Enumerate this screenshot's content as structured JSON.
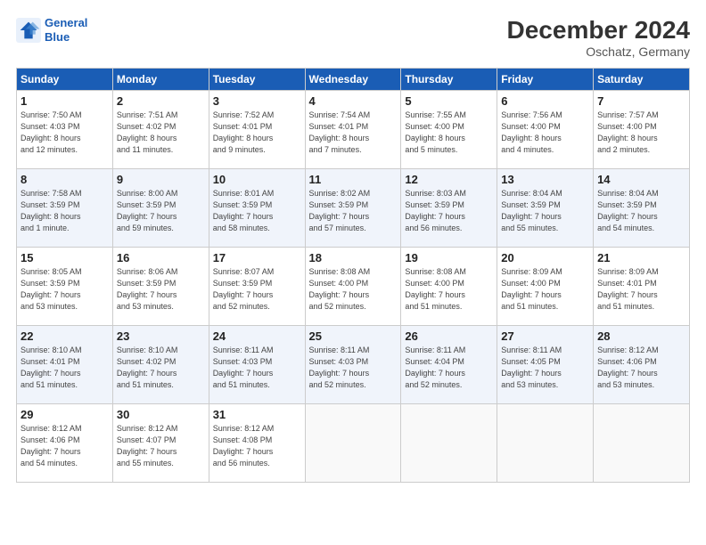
{
  "header": {
    "logo_line1": "General",
    "logo_line2": "Blue",
    "month_year": "December 2024",
    "location": "Oschatz, Germany"
  },
  "weekdays": [
    "Sunday",
    "Monday",
    "Tuesday",
    "Wednesday",
    "Thursday",
    "Friday",
    "Saturday"
  ],
  "weeks": [
    [
      {
        "day": "1",
        "info": "Sunrise: 7:50 AM\nSunset: 4:03 PM\nDaylight: 8 hours\nand 12 minutes."
      },
      {
        "day": "2",
        "info": "Sunrise: 7:51 AM\nSunset: 4:02 PM\nDaylight: 8 hours\nand 11 minutes."
      },
      {
        "day": "3",
        "info": "Sunrise: 7:52 AM\nSunset: 4:01 PM\nDaylight: 8 hours\nand 9 minutes."
      },
      {
        "day": "4",
        "info": "Sunrise: 7:54 AM\nSunset: 4:01 PM\nDaylight: 8 hours\nand 7 minutes."
      },
      {
        "day": "5",
        "info": "Sunrise: 7:55 AM\nSunset: 4:00 PM\nDaylight: 8 hours\nand 5 minutes."
      },
      {
        "day": "6",
        "info": "Sunrise: 7:56 AM\nSunset: 4:00 PM\nDaylight: 8 hours\nand 4 minutes."
      },
      {
        "day": "7",
        "info": "Sunrise: 7:57 AM\nSunset: 4:00 PM\nDaylight: 8 hours\nand 2 minutes."
      }
    ],
    [
      {
        "day": "8",
        "info": "Sunrise: 7:58 AM\nSunset: 3:59 PM\nDaylight: 8 hours\nand 1 minute."
      },
      {
        "day": "9",
        "info": "Sunrise: 8:00 AM\nSunset: 3:59 PM\nDaylight: 7 hours\nand 59 minutes."
      },
      {
        "day": "10",
        "info": "Sunrise: 8:01 AM\nSunset: 3:59 PM\nDaylight: 7 hours\nand 58 minutes."
      },
      {
        "day": "11",
        "info": "Sunrise: 8:02 AM\nSunset: 3:59 PM\nDaylight: 7 hours\nand 57 minutes."
      },
      {
        "day": "12",
        "info": "Sunrise: 8:03 AM\nSunset: 3:59 PM\nDaylight: 7 hours\nand 56 minutes."
      },
      {
        "day": "13",
        "info": "Sunrise: 8:04 AM\nSunset: 3:59 PM\nDaylight: 7 hours\nand 55 minutes."
      },
      {
        "day": "14",
        "info": "Sunrise: 8:04 AM\nSunset: 3:59 PM\nDaylight: 7 hours\nand 54 minutes."
      }
    ],
    [
      {
        "day": "15",
        "info": "Sunrise: 8:05 AM\nSunset: 3:59 PM\nDaylight: 7 hours\nand 53 minutes."
      },
      {
        "day": "16",
        "info": "Sunrise: 8:06 AM\nSunset: 3:59 PM\nDaylight: 7 hours\nand 53 minutes."
      },
      {
        "day": "17",
        "info": "Sunrise: 8:07 AM\nSunset: 3:59 PM\nDaylight: 7 hours\nand 52 minutes."
      },
      {
        "day": "18",
        "info": "Sunrise: 8:08 AM\nSunset: 4:00 PM\nDaylight: 7 hours\nand 52 minutes."
      },
      {
        "day": "19",
        "info": "Sunrise: 8:08 AM\nSunset: 4:00 PM\nDaylight: 7 hours\nand 51 minutes."
      },
      {
        "day": "20",
        "info": "Sunrise: 8:09 AM\nSunset: 4:00 PM\nDaylight: 7 hours\nand 51 minutes."
      },
      {
        "day": "21",
        "info": "Sunrise: 8:09 AM\nSunset: 4:01 PM\nDaylight: 7 hours\nand 51 minutes."
      }
    ],
    [
      {
        "day": "22",
        "info": "Sunrise: 8:10 AM\nSunset: 4:01 PM\nDaylight: 7 hours\nand 51 minutes."
      },
      {
        "day": "23",
        "info": "Sunrise: 8:10 AM\nSunset: 4:02 PM\nDaylight: 7 hours\nand 51 minutes."
      },
      {
        "day": "24",
        "info": "Sunrise: 8:11 AM\nSunset: 4:03 PM\nDaylight: 7 hours\nand 51 minutes."
      },
      {
        "day": "25",
        "info": "Sunrise: 8:11 AM\nSunset: 4:03 PM\nDaylight: 7 hours\nand 52 minutes."
      },
      {
        "day": "26",
        "info": "Sunrise: 8:11 AM\nSunset: 4:04 PM\nDaylight: 7 hours\nand 52 minutes."
      },
      {
        "day": "27",
        "info": "Sunrise: 8:11 AM\nSunset: 4:05 PM\nDaylight: 7 hours\nand 53 minutes."
      },
      {
        "day": "28",
        "info": "Sunrise: 8:12 AM\nSunset: 4:06 PM\nDaylight: 7 hours\nand 53 minutes."
      }
    ],
    [
      {
        "day": "29",
        "info": "Sunrise: 8:12 AM\nSunset: 4:06 PM\nDaylight: 7 hours\nand 54 minutes."
      },
      {
        "day": "30",
        "info": "Sunrise: 8:12 AM\nSunset: 4:07 PM\nDaylight: 7 hours\nand 55 minutes."
      },
      {
        "day": "31",
        "info": "Sunrise: 8:12 AM\nSunset: 4:08 PM\nDaylight: 7 hours\nand 56 minutes."
      },
      {
        "day": "",
        "info": ""
      },
      {
        "day": "",
        "info": ""
      },
      {
        "day": "",
        "info": ""
      },
      {
        "day": "",
        "info": ""
      }
    ]
  ]
}
